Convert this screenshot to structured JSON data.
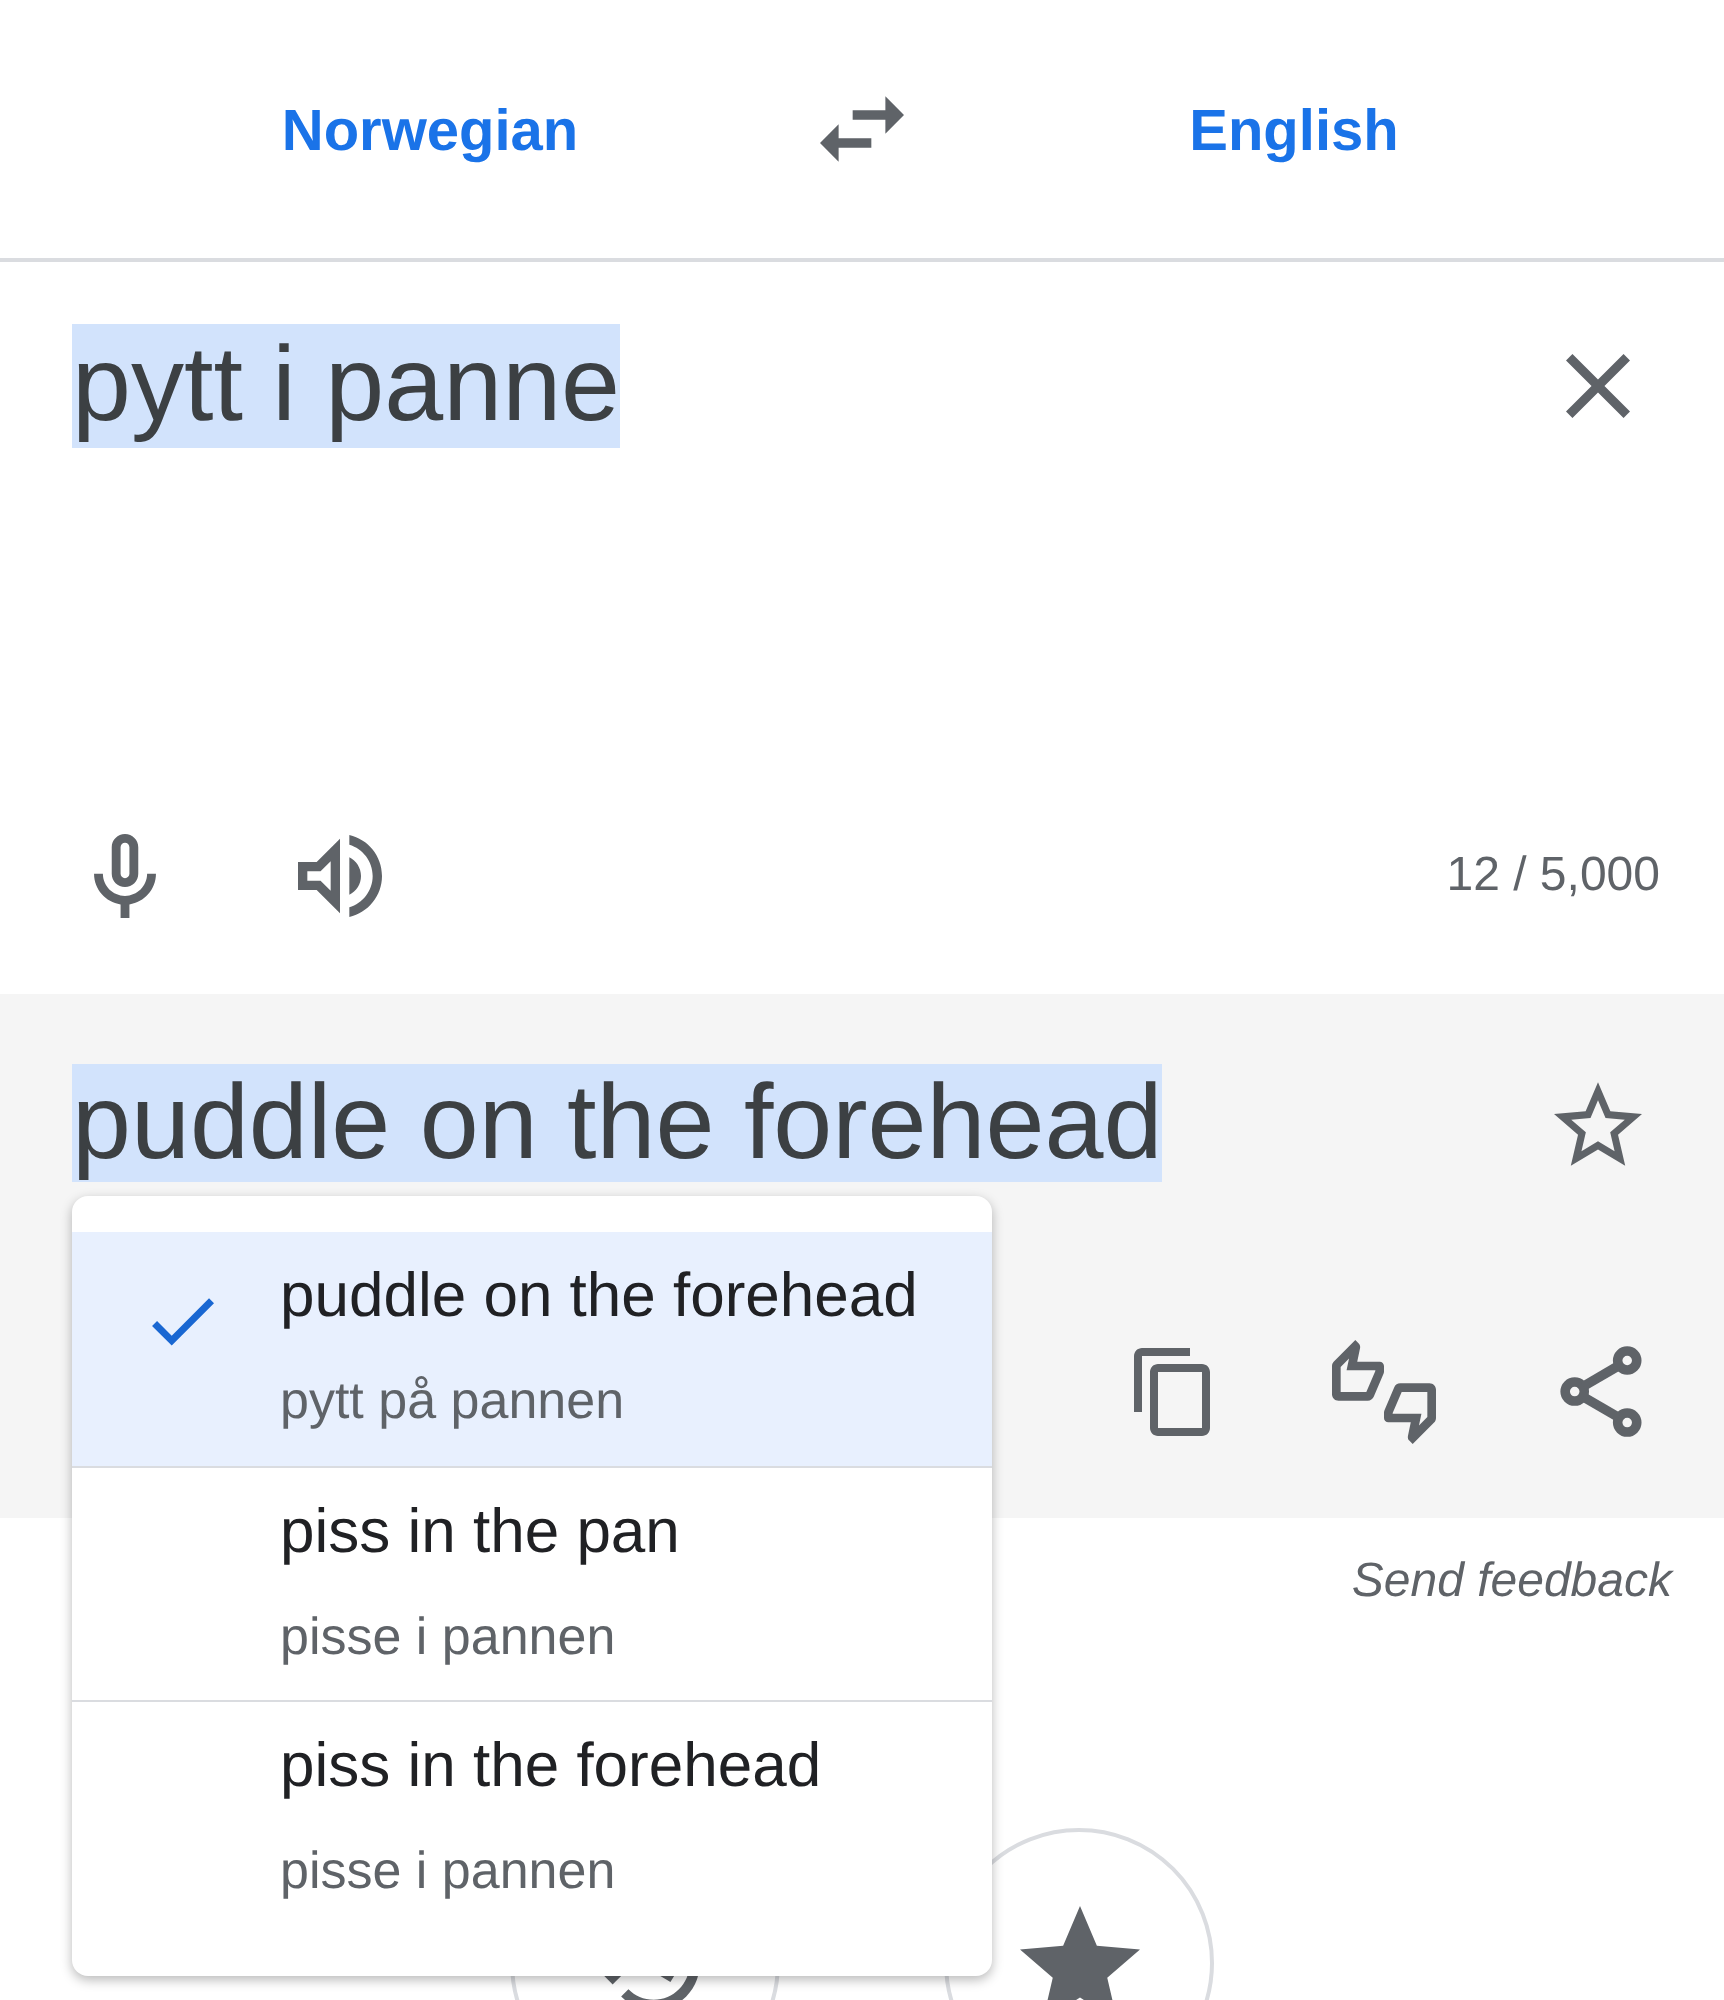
{
  "language_bar": {
    "source": "Norwegian",
    "target": "English"
  },
  "input": {
    "text": "pytt i panne",
    "selected": true,
    "char_count": "12 / 5,000"
  },
  "output": {
    "text": "puddle on the forehead",
    "selected": true,
    "starred": false
  },
  "alternatives_menu": {
    "items": [
      {
        "translation": "puddle on the forehead",
        "back_translation": "pytt på pannen",
        "selected": true
      },
      {
        "translation": "piss in the pan",
        "back_translation": "pisse i pannen",
        "selected": false
      },
      {
        "translation": "piss in the forehead",
        "back_translation": "pisse i pannen",
        "selected": false
      }
    ]
  },
  "feedback_link": "Send feedback",
  "bottom_buttons": [
    {
      "kind": "history"
    },
    {
      "kind": "saved"
    }
  ]
}
